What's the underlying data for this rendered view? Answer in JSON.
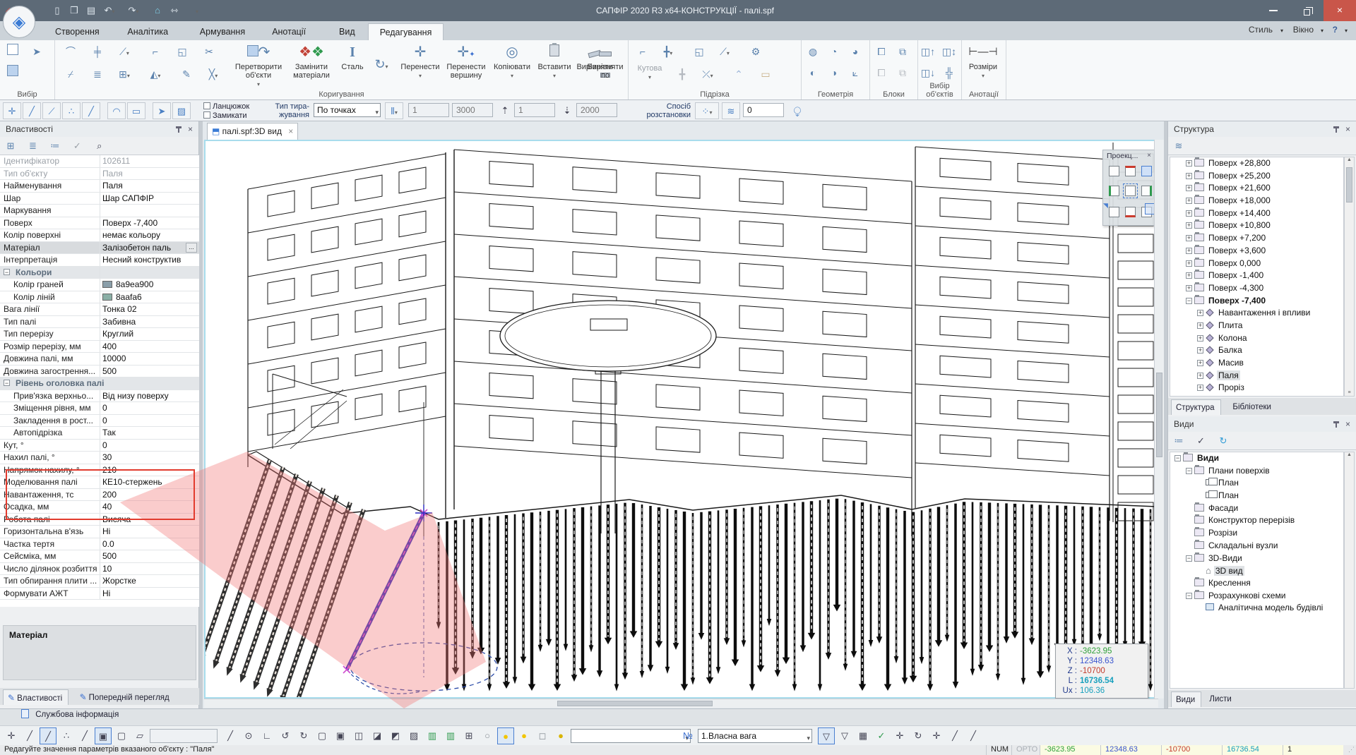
{
  "colors": {
    "titlebar": "#5d6a77",
    "close_button": "#c9564a",
    "accent": "#3a7bd5",
    "annotation_red": "#e23b2e",
    "annotation_pink": "rgba(243,120,120,0.38)",
    "coord_x": "#2fa13a",
    "coord_y": "#3a55cf",
    "coord_z": "#c23a2b",
    "coord_l": "#18a0bd",
    "swatch_faces": "#8a9ea9",
    "swatch_lines": "#8aafa6"
  },
  "window": {
    "title": "САПФІР 2020 R3 x64-КОНСТРУКЦІЇ - палі.spf"
  },
  "menubar": {
    "tabs": [
      "Створення",
      "Аналітика",
      "Армування",
      "Анотації",
      "Вид",
      "Редагування"
    ],
    "active_tab": "Редагування",
    "right": {
      "style": "Стиль",
      "window": "Вікно",
      "help": "?"
    }
  },
  "ribbon": {
    "groups": {
      "select": "Вибір",
      "modify": "Коригування",
      "trim": "Підрізка",
      "geometry": "Геометрія",
      "blocks": "Блоки",
      "object_select": "Вибір об'єктів",
      "annotations": "Анотації"
    },
    "buttons": {
      "convert": "Перетворити об'єкти",
      "replace_materials": "Замінити матеріали",
      "steel": "Сталь",
      "move": "Перенести",
      "move_vertex": "Перенести вершину",
      "copy": "Копіювати",
      "paste": "Вставити",
      "align": "Вирівняти",
      "align_to": "Вирівняти по",
      "angular": "Кутова",
      "dimensions": "Розміри"
    }
  },
  "options_bar": {
    "chain": "Ланцюжок",
    "close_loop": "Замикати",
    "type_label_1": "Тип тира-",
    "type_label_2": "жування",
    "type_combo": "По точках",
    "f1": "1",
    "f2": "3000",
    "f3": "1",
    "f4": "2000",
    "method_1": "Спосіб",
    "method_2": "розстановки",
    "f5": "0"
  },
  "properties": {
    "title": "Властивості",
    "rows": [
      {
        "l": "Ідентифікатор",
        "v": "102611",
        "ro": 1
      },
      {
        "l": "Тип об'єкту",
        "v": "Паля",
        "ro": 1
      },
      {
        "l": "Найменування",
        "v": "Паля"
      },
      {
        "l": "Шар",
        "v": "Шар САПФІР"
      },
      {
        "l": "Маркування",
        "v": ""
      },
      {
        "l": "Поверх",
        "v": "Поверх -7,400"
      },
      {
        "l": "Колір поверхні",
        "v": "немає кольору"
      },
      {
        "l": "Матеріал",
        "v": "Залізобетон паль",
        "hl": 1,
        "dots": "..."
      },
      {
        "l": "Інтерпретація",
        "v": "Несний конструктив"
      },
      {
        "t": "sec",
        "l": "Кольори"
      },
      {
        "l": "Колір граней",
        "v": "8a9ea900",
        "ind": 1,
        "sw": "#8a9ea9"
      },
      {
        "l": "Колір ліній",
        "v": "8aafa6",
        "ind": 1,
        "sw": "#8aafa6"
      },
      {
        "l": "Вага лінії",
        "v": "Тонка 02"
      },
      {
        "l": "Тип палі",
        "v": "Забивна"
      },
      {
        "l": "Тип перерізу",
        "v": "Круглий"
      },
      {
        "l": "Розмір перерізу, мм",
        "v": "400"
      },
      {
        "l": "Довжина палі, мм",
        "v": "10000"
      },
      {
        "l": "Довжина загострення...",
        "v": "500"
      },
      {
        "t": "sec",
        "l": "Рівень оголовка палі"
      },
      {
        "l": "Прив'язка верхньо...",
        "v": "Від низу поверху",
        "ind": 1
      },
      {
        "l": "Зміщення рівня, мм",
        "v": "0",
        "ind": 1
      },
      {
        "l": "Закладення в рост...",
        "v": "0",
        "ind": 1
      },
      {
        "l": "Автопідрізка",
        "v": "Так",
        "ind": 1
      },
      {
        "l": "Кут, °",
        "v": "0"
      },
      {
        "l": "Нахил палі, °",
        "v": "30"
      },
      {
        "l": "Напрямок нахилу, °",
        "v": "210"
      },
      {
        "l": "Моделювання палі",
        "v": "КЕ10-стержень"
      },
      {
        "l": "Навантаження, тс",
        "v": "200"
      },
      {
        "l": "Осадка, мм",
        "v": "40"
      },
      {
        "l": "Робота палі",
        "v": "Висяча"
      },
      {
        "l": "Горизонтальна в'язь",
        "v": "Ні"
      },
      {
        "l": "Частка тертя",
        "v": "0.0"
      },
      {
        "l": "Сейсміка, мм",
        "v": "500"
      },
      {
        "l": "Число ділянок розбиття",
        "v": "10"
      },
      {
        "l": "Тип обпирання плити ...",
        "v": "Жорстке"
      },
      {
        "l": "Формувати АЖТ",
        "v": "Ні"
      }
    ],
    "material_label": "Матеріал",
    "tabs": [
      "Властивості",
      "Попередній перегляд"
    ],
    "active_tab": "Властивості"
  },
  "service_bar": {
    "label": "Службова інформація"
  },
  "viewport": {
    "tab": "палі.spf:3D вид",
    "projections_title": "Проекц...",
    "coord_box": [
      {
        "k": "X :",
        "v": "-3623.95",
        "c": "#2fa13a"
      },
      {
        "k": "Y :",
        "v": "12348.63",
        "c": "#3a55cf"
      },
      {
        "k": "Z :",
        "v": "-10700",
        "c": "#c23a2b"
      },
      {
        "k": "L :",
        "v": "16736.54",
        "c": "#18a0bd",
        "b": 1
      },
      {
        "k": "Ux :",
        "v": "106.36",
        "c": "#18a0bd"
      }
    ]
  },
  "structure": {
    "title": "Структура",
    "rows": [
      {
        "t": "Поверх +28,800",
        "d": 1,
        "i": "folder",
        "e": "+"
      },
      {
        "t": "Поверх +25,200",
        "d": 1,
        "i": "folder",
        "e": "+"
      },
      {
        "t": "Поверх +21,600",
        "d": 1,
        "i": "folder",
        "e": "+"
      },
      {
        "t": "Поверх +18,000",
        "d": 1,
        "i": "folder",
        "e": "+"
      },
      {
        "t": "Поверх +14,400",
        "d": 1,
        "i": "folder",
        "e": "+"
      },
      {
        "t": "Поверх +10,800",
        "d": 1,
        "i": "folder",
        "e": "+"
      },
      {
        "t": "Поверх +7,200",
        "d": 1,
        "i": "folder",
        "e": "+"
      },
      {
        "t": "Поверх +3,600",
        "d": 1,
        "i": "folder",
        "e": "+"
      },
      {
        "t": "Поверх 0,000",
        "d": 1,
        "i": "folder",
        "e": "+"
      },
      {
        "t": "Поверх -1,400",
        "d": 1,
        "i": "folder",
        "e": "+"
      },
      {
        "t": "Поверх -4,300",
        "d": 1,
        "i": "folder",
        "e": "+"
      },
      {
        "t": "Поверх -7,400",
        "d": 1,
        "i": "folder",
        "e": "-",
        "b": 1
      },
      {
        "t": "Навантаження і впливи",
        "d": 2,
        "i": "diamond",
        "e": "+"
      },
      {
        "t": "Плита",
        "d": 2,
        "i": "diamond",
        "e": "+"
      },
      {
        "t": "Колона",
        "d": 2,
        "i": "diamond",
        "e": "+"
      },
      {
        "t": "Балка",
        "d": 2,
        "i": "diamond",
        "e": "+"
      },
      {
        "t": "Масив",
        "d": 2,
        "i": "diamond",
        "e": "+"
      },
      {
        "t": "Паля",
        "d": 2,
        "i": "diamond",
        "e": "+",
        "sel": 1
      },
      {
        "t": "Проріз",
        "d": 2,
        "i": "diamond",
        "e": "+"
      }
    ],
    "tabs": [
      "Структура",
      "Бібліотеки"
    ],
    "active_tab": "Структура"
  },
  "views": {
    "title": "Види",
    "rows": [
      {
        "t": "Види",
        "d": 0,
        "i": "folder",
        "e": "-",
        "b": 1
      },
      {
        "t": "Плани поверхів",
        "d": 1,
        "i": "folder",
        "e": "-"
      },
      {
        "t": "План",
        "d": 2,
        "i": "plan"
      },
      {
        "t": "План",
        "d": 2,
        "i": "plan"
      },
      {
        "t": "Фасади",
        "d": 1,
        "i": "folder"
      },
      {
        "t": "Конструктор перерізів",
        "d": 1,
        "i": "folder"
      },
      {
        "t": "Розрізи",
        "d": 1,
        "i": "folder"
      },
      {
        "t": "Складальні вузли",
        "d": 1,
        "i": "folder"
      },
      {
        "t": "3D-Види",
        "d": 1,
        "i": "folder",
        "e": "-"
      },
      {
        "t": "3D вид",
        "d": 2,
        "i": "house",
        "sel": 1
      },
      {
        "t": "Креслення",
        "d": 1,
        "i": "folder"
      },
      {
        "t": "Розрахункові схеми",
        "d": 1,
        "i": "folder",
        "e": "-"
      },
      {
        "t": "Аналітична модель будівлі",
        "d": 2,
        "i": "model"
      }
    ],
    "tabs": [
      "Види",
      "Листи"
    ],
    "active_tab": "Види"
  },
  "bottom_toolbar": {
    "load_case_combo": "1.Власна вага",
    "left_icons": [
      {
        "n": "snap-move-icon",
        "g": "✛"
      },
      {
        "n": "snap-line-icon",
        "g": "╱"
      },
      {
        "n": "snap-guide-icon",
        "g": "╱",
        "cls": "act"
      },
      {
        "n": "snap-points-icon",
        "g": "∴"
      },
      {
        "n": "snap-axis-icon",
        "g": "╱"
      },
      {
        "n": "lock-solid-icon",
        "g": "▣",
        "cls": "act"
      },
      {
        "n": "lock-free-icon",
        "g": "▢"
      },
      {
        "n": "skew-icon",
        "g": "▱"
      },
      {
        "n": "angle-field",
        "g": "",
        "field": 1
      },
      {
        "n": "draw-line-icon",
        "g": "╱"
      },
      {
        "n": "draw-circle-icon",
        "g": "⊙"
      },
      {
        "n": "perpendicular-icon",
        "g": "∟"
      },
      {
        "n": "rotate-x-icon",
        "g": "↺"
      },
      {
        "n": "rotate-y-icon",
        "g": "↻"
      },
      {
        "n": "vis-wire-icon",
        "g": "▢"
      },
      {
        "n": "vis-solid-icon",
        "g": "▣"
      },
      {
        "n": "vis-hide-icon",
        "g": "◫"
      },
      {
        "n": "vis-section-icon",
        "g": "◪"
      },
      {
        "n": "vis-settings-icon",
        "g": "◩"
      },
      {
        "n": "vis-hatch-icon",
        "g": "▨"
      },
      {
        "n": "model-cube1-icon",
        "g": "▥",
        "c": "#2f9a4e"
      },
      {
        "n": "model-cube2-icon",
        "g": "▥",
        "c": "#2f9a4e"
      },
      {
        "n": "grid-icon",
        "g": "⊞"
      },
      {
        "n": "lamp-off-icon",
        "g": "○",
        "c": "#8a9097"
      },
      {
        "n": "lamp-on-icon",
        "g": "●",
        "c": "#f2c500",
        "cls": "act"
      },
      {
        "n": "lamp-obj-icon",
        "g": "●",
        "c": "#f2c500"
      },
      {
        "n": "lamp-box-icon",
        "g": "◻",
        "c": "#8a9097"
      },
      {
        "n": "lamp-group-icon",
        "g": "●",
        "c": "#d8b400"
      },
      {
        "n": "layer-combo",
        "g": "",
        "combo": 1
      },
      {
        "n": "layers-icon",
        "g": "≣",
        "c": "#3a6fd0"
      }
    ],
    "right_icons": [
      {
        "n": "numbering-icon",
        "g": "№",
        "c": "#3a6fd0"
      },
      {
        "n": "load-case-combo",
        "combo2": 1
      },
      {
        "n": "filter-active-icon",
        "g": "▽",
        "cls": "act"
      },
      {
        "n": "filter-cursor-icon",
        "g": "▽"
      },
      {
        "n": "filter-table-icon",
        "g": "▦"
      },
      {
        "n": "apply-check-icon",
        "g": "✓",
        "c": "#2f9a4e"
      },
      {
        "n": "pan-icon",
        "g": "✛"
      },
      {
        "n": "orbit-icon",
        "g": "↻"
      },
      {
        "n": "move-small-icon",
        "g": "✛"
      },
      {
        "n": "slope1-icon",
        "g": "╱"
      },
      {
        "n": "slope2-icon",
        "g": "╱"
      }
    ]
  },
  "statusbar": {
    "message": "Редагуйте значення параметрів вказаного об'єкту : \"Паля\"",
    "num": "NUM",
    "orto": "ОРТО",
    "cells": [
      {
        "v": "-3623.95",
        "c": "#2fa13a"
      },
      {
        "v": "12348.63",
        "c": "#3a55cf"
      },
      {
        "v": "-10700",
        "c": "#c23a2b"
      },
      {
        "v": "16736.54",
        "c": "#18a0bd"
      },
      {
        "v": "1",
        "c": "#222222"
      }
    ]
  }
}
